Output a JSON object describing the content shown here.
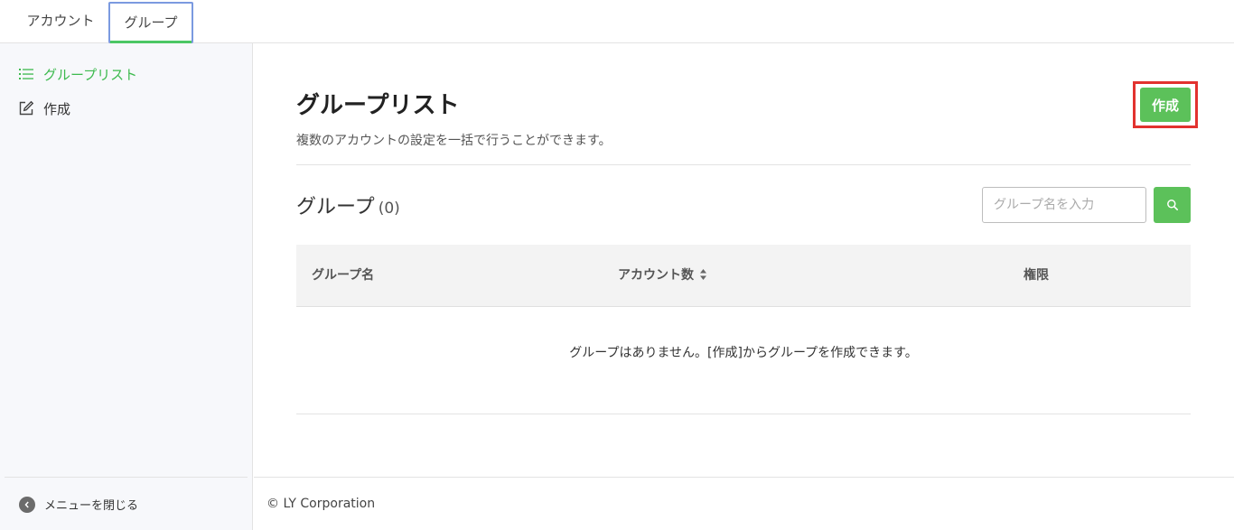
{
  "tabs": [
    {
      "label": "アカウント"
    },
    {
      "label": "グループ"
    }
  ],
  "sidebar": {
    "items": [
      {
        "label": "グループリスト",
        "icon": "list-icon"
      },
      {
        "label": "作成",
        "icon": "edit-icon"
      }
    ],
    "close_menu": "メニューを閉じる"
  },
  "main": {
    "title": "グループリスト",
    "description": "複数のアカウントの設定を一括で行うことができます。",
    "create_label": "作成",
    "section_title": "グループ",
    "section_count": "(0)",
    "search_placeholder": "グループ名を入力",
    "table": {
      "columns": [
        "グループ名",
        "アカウント数",
        "権限"
      ],
      "empty_message": "グループはありません。[作成]からグループを作成できます。"
    }
  },
  "footer": {
    "copyright": "© LY Corporation"
  },
  "colors": {
    "accent": "#5cc15a",
    "active_text": "#3dba4e",
    "highlight_border": "#e2322f",
    "tab_focus": "#7b9ae0"
  }
}
